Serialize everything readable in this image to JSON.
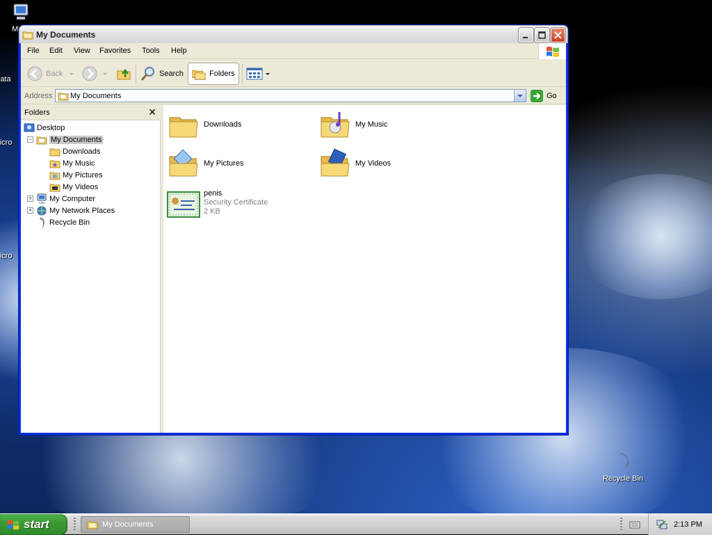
{
  "desktop": {
    "icons": [
      {
        "label": "My Computer",
        "visible_text": "My C"
      },
      {
        "label": "Data",
        "visible_text": "Data"
      },
      {
        "label": "Micro",
        "visible_text": "Micro"
      },
      {
        "label": "Micro Ba",
        "visible_text": "Micro"
      },
      {
        "label": "Recycle Bin",
        "visible_text": "Recycle Bin"
      }
    ]
  },
  "window": {
    "title": "My Documents",
    "menu": [
      "File",
      "Edit",
      "View",
      "Favorites",
      "Tools",
      "Help"
    ],
    "toolbar": {
      "back_label": "Back",
      "search_label": "Search",
      "folders_label": "Folders"
    },
    "address": {
      "label": "Address",
      "value": "My Documents",
      "go_label": "Go"
    },
    "folders_pane": {
      "header": "Folders",
      "close_glyph": "✕",
      "tree": [
        {
          "label": "Desktop"
        },
        {
          "label": "My Documents"
        },
        {
          "label": "Downloads"
        },
        {
          "label": "My Music"
        },
        {
          "label": "My Pictures"
        },
        {
          "label": "My Videos"
        },
        {
          "label": "My Computer"
        },
        {
          "label": "My Network Places"
        },
        {
          "label": "Recycle Bin"
        }
      ]
    },
    "files": [
      {
        "name": "Downloads"
      },
      {
        "name": "My Music"
      },
      {
        "name": "My Pictures"
      },
      {
        "name": "My Videos"
      },
      {
        "name": "penis",
        "type": "Security Certificate",
        "size": "2 KB"
      }
    ]
  },
  "taskbar": {
    "start_label": "start",
    "task_label": "My Documents",
    "clock": "2:13 PM"
  },
  "colors": {
    "xp_blue": "#0831d9",
    "start_green": "#3b9a36",
    "folder_yellow": "#f5d26a"
  }
}
